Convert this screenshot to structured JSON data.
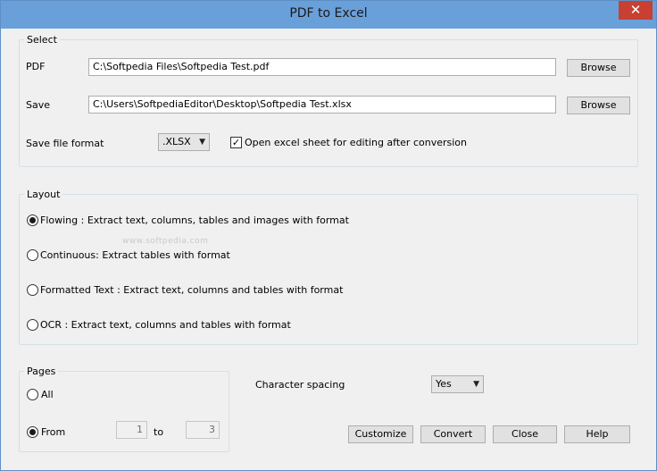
{
  "window": {
    "title": "PDF to Excel",
    "close_glyph": "✕"
  },
  "select_group": {
    "legend": "Select",
    "pdf_label": "PDF",
    "pdf_value": "C:\\Softpedia Files\\Softpedia Test.pdf",
    "save_label": "Save",
    "save_value": "C:\\Users\\SoftpediaEditor\\Desktop\\Softpedia Test.xlsx",
    "browse_label": "Browse",
    "format_label": "Save file format",
    "format_value": ".XLSX",
    "open_checkbox_label": "Open excel sheet for editing after conversion",
    "open_checked": true
  },
  "layout_group": {
    "legend": "Layout",
    "options": [
      {
        "label": "Flowing :  Extract text, columns, tables and images with format",
        "checked": true
      },
      {
        "label": "Continuous: Extract tables with format",
        "checked": false
      },
      {
        "label": "Formatted Text :  Extract text, columns and tables with format",
        "checked": false
      },
      {
        "label": "OCR :  Extract text, columns and tables with format",
        "checked": false
      }
    ],
    "watermark": "www.softpedia.com"
  },
  "pages_group": {
    "legend": "Pages",
    "all_label": "All",
    "all_checked": false,
    "from_label": "From",
    "from_checked": true,
    "from_value": "1",
    "to_label": "to",
    "to_value": "3"
  },
  "character_spacing": {
    "label": "Character spacing",
    "value": "Yes"
  },
  "buttons": {
    "customize": "Customize",
    "convert": "Convert",
    "close": "Close",
    "help": "Help"
  },
  "icons": {
    "dropdown": "chevron-down-icon",
    "check": "checkmark-icon"
  }
}
